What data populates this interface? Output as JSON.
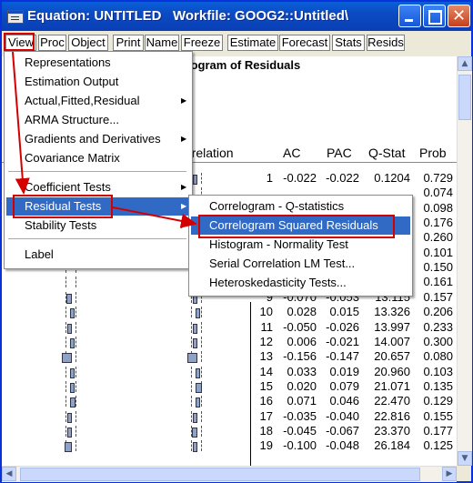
{
  "window": {
    "title": "Equation: UNTITLED   Workfile: GOOG2::Untitled\\"
  },
  "toolbar": {
    "buttons": [
      "View",
      "Proc",
      "Object",
      "Print",
      "Name",
      "Freeze",
      "Estimate",
      "Forecast",
      "Stats",
      "Resids"
    ]
  },
  "content": {
    "header": "logram of Residuals",
    "columns": [
      "rrelation",
      "AC",
      "PAC",
      "Q-Stat",
      "Prob"
    ],
    "rows": [
      [
        "1",
        "-0.022",
        "-0.022",
        "0.1204",
        "0.729"
      ],
      [
        "",
        "",
        "",
        "",
        "0.074"
      ],
      [
        "",
        "",
        "",
        "",
        "0.098"
      ],
      [
        "",
        "",
        "",
        "",
        "0.176"
      ],
      [
        "",
        "",
        "",
        "",
        "0.260"
      ],
      [
        "",
        "",
        "",
        "",
        "0.101"
      ],
      [
        "",
        "",
        "",
        "",
        "0.150"
      ],
      [
        "",
        "",
        "",
        "",
        "0.161"
      ],
      [
        "9",
        "-0.070",
        "-0.053",
        "13.115",
        "0.157"
      ],
      [
        "10",
        "0.028",
        "0.015",
        "13.326",
        "0.206"
      ],
      [
        "11",
        "-0.050",
        "-0.026",
        "13.997",
        "0.233"
      ],
      [
        "12",
        "0.006",
        "-0.021",
        "14.007",
        "0.300"
      ],
      [
        "13",
        "-0.156",
        "-0.147",
        "20.657",
        "0.080"
      ],
      [
        "14",
        "0.033",
        "0.019",
        "20.960",
        "0.103"
      ],
      [
        "15",
        "0.020",
        "0.079",
        "21.071",
        "0.135"
      ],
      [
        "16",
        "0.071",
        "0.046",
        "22.470",
        "0.129"
      ],
      [
        "17",
        "-0.035",
        "-0.040",
        "22.816",
        "0.155"
      ],
      [
        "18",
        "-0.045",
        "-0.067",
        "23.370",
        "0.177"
      ],
      [
        "19",
        "-0.100",
        "-0.048",
        "26.184",
        "0.125"
      ]
    ]
  },
  "view_menu": {
    "items": [
      "Representations",
      "Estimation Output",
      "Actual,Fitted,Residual",
      "ARMA Structure...",
      "Gradients and Derivatives",
      "Covariance Matrix",
      "Coefficient Tests",
      "Residual Tests",
      "Stability Tests",
      "Label"
    ]
  },
  "residual_menu": {
    "items": [
      "Correlogram - Q-statistics",
      "Correlogram Squared Residuals",
      "Histogram - Normality Test",
      "Serial Correlation LM Test...",
      "Heteroskedasticity Tests..."
    ]
  },
  "colors": {
    "menu_highlight": "#316ac5",
    "annotation_red": "#d40000",
    "title_blue": "#0b4bc4"
  },
  "icons": [
    "system-menu-icon",
    "minimize-icon",
    "maximize-icon",
    "close-icon",
    "submenu-arrow-icon"
  ]
}
